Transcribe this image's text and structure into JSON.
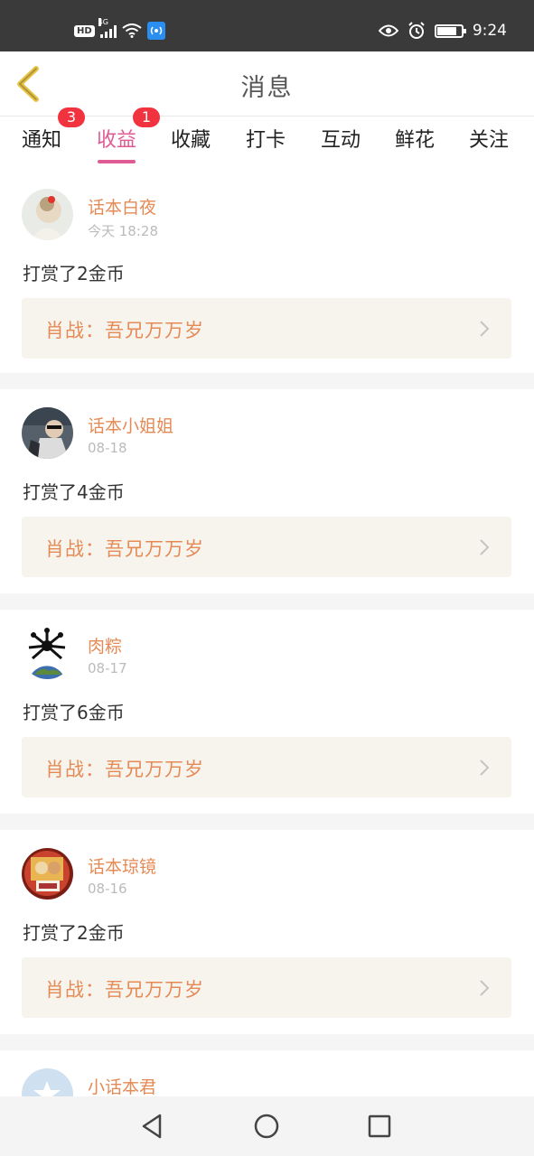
{
  "status_bar": {
    "hd": "HD",
    "network": "4G",
    "time": "9:24",
    "battery_level": 0.75
  },
  "header": {
    "title": "消息"
  },
  "tabs": [
    {
      "label": "通知",
      "badge": "3"
    },
    {
      "label": "收益",
      "badge": "1",
      "active": true
    },
    {
      "label": "收藏"
    },
    {
      "label": "打卡"
    },
    {
      "label": "互动"
    },
    {
      "label": "鲜花"
    },
    {
      "label": "关注"
    }
  ],
  "messages": [
    {
      "user": "话本白夜",
      "date": "今天 18:28",
      "text": "打赏了2金币",
      "work": "肖战：吾兄万万岁"
    },
    {
      "user": "话本小姐姐",
      "date": "08-18",
      "text": "打赏了4金币",
      "work": "肖战：吾兄万万岁"
    },
    {
      "user": "肉粽",
      "date": "08-17",
      "text": "打赏了6金币",
      "work": "肖战：吾兄万万岁"
    },
    {
      "user": "话本琼镜",
      "date": "08-16",
      "text": "打赏了2金币",
      "work": "肖战：吾兄万万岁"
    },
    {
      "user": "小话本君",
      "date": "",
      "text": "",
      "work": ""
    }
  ],
  "colors": {
    "accent": "#e05b93",
    "username": "#e58a55",
    "badge": "#f0333f",
    "work_bg": "#f6f4ed"
  }
}
